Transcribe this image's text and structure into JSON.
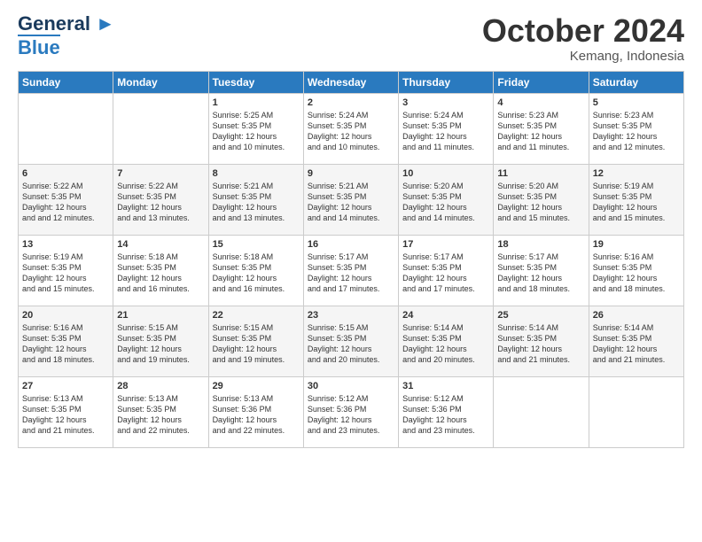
{
  "header": {
    "logo_line1": "General",
    "logo_line2": "Blue",
    "month_title": "October 2024",
    "location": "Kemang, Indonesia"
  },
  "days_of_week": [
    "Sunday",
    "Monday",
    "Tuesday",
    "Wednesday",
    "Thursday",
    "Friday",
    "Saturday"
  ],
  "weeks": [
    [
      {
        "day": "",
        "sunrise": "",
        "sunset": "",
        "daylight": ""
      },
      {
        "day": "",
        "sunrise": "",
        "sunset": "",
        "daylight": ""
      },
      {
        "day": "1",
        "sunrise": "Sunrise: 5:25 AM",
        "sunset": "Sunset: 5:35 PM",
        "daylight": "Daylight: 12 hours and 10 minutes."
      },
      {
        "day": "2",
        "sunrise": "Sunrise: 5:24 AM",
        "sunset": "Sunset: 5:35 PM",
        "daylight": "Daylight: 12 hours and 10 minutes."
      },
      {
        "day": "3",
        "sunrise": "Sunrise: 5:24 AM",
        "sunset": "Sunset: 5:35 PM",
        "daylight": "Daylight: 12 hours and 11 minutes."
      },
      {
        "day": "4",
        "sunrise": "Sunrise: 5:23 AM",
        "sunset": "Sunset: 5:35 PM",
        "daylight": "Daylight: 12 hours and 11 minutes."
      },
      {
        "day": "5",
        "sunrise": "Sunrise: 5:23 AM",
        "sunset": "Sunset: 5:35 PM",
        "daylight": "Daylight: 12 hours and 12 minutes."
      }
    ],
    [
      {
        "day": "6",
        "sunrise": "Sunrise: 5:22 AM",
        "sunset": "Sunset: 5:35 PM",
        "daylight": "Daylight: 12 hours and 12 minutes."
      },
      {
        "day": "7",
        "sunrise": "Sunrise: 5:22 AM",
        "sunset": "Sunset: 5:35 PM",
        "daylight": "Daylight: 12 hours and 13 minutes."
      },
      {
        "day": "8",
        "sunrise": "Sunrise: 5:21 AM",
        "sunset": "Sunset: 5:35 PM",
        "daylight": "Daylight: 12 hours and 13 minutes."
      },
      {
        "day": "9",
        "sunrise": "Sunrise: 5:21 AM",
        "sunset": "Sunset: 5:35 PM",
        "daylight": "Daylight: 12 hours and 14 minutes."
      },
      {
        "day": "10",
        "sunrise": "Sunrise: 5:20 AM",
        "sunset": "Sunset: 5:35 PM",
        "daylight": "Daylight: 12 hours and 14 minutes."
      },
      {
        "day": "11",
        "sunrise": "Sunrise: 5:20 AM",
        "sunset": "Sunset: 5:35 PM",
        "daylight": "Daylight: 12 hours and 15 minutes."
      },
      {
        "day": "12",
        "sunrise": "Sunrise: 5:19 AM",
        "sunset": "Sunset: 5:35 PM",
        "daylight": "Daylight: 12 hours and 15 minutes."
      }
    ],
    [
      {
        "day": "13",
        "sunrise": "Sunrise: 5:19 AM",
        "sunset": "Sunset: 5:35 PM",
        "daylight": "Daylight: 12 hours and 15 minutes."
      },
      {
        "day": "14",
        "sunrise": "Sunrise: 5:18 AM",
        "sunset": "Sunset: 5:35 PM",
        "daylight": "Daylight: 12 hours and 16 minutes."
      },
      {
        "day": "15",
        "sunrise": "Sunrise: 5:18 AM",
        "sunset": "Sunset: 5:35 PM",
        "daylight": "Daylight: 12 hours and 16 minutes."
      },
      {
        "day": "16",
        "sunrise": "Sunrise: 5:17 AM",
        "sunset": "Sunset: 5:35 PM",
        "daylight": "Daylight: 12 hours and 17 minutes."
      },
      {
        "day": "17",
        "sunrise": "Sunrise: 5:17 AM",
        "sunset": "Sunset: 5:35 PM",
        "daylight": "Daylight: 12 hours and 17 minutes."
      },
      {
        "day": "18",
        "sunrise": "Sunrise: 5:17 AM",
        "sunset": "Sunset: 5:35 PM",
        "daylight": "Daylight: 12 hours and 18 minutes."
      },
      {
        "day": "19",
        "sunrise": "Sunrise: 5:16 AM",
        "sunset": "Sunset: 5:35 PM",
        "daylight": "Daylight: 12 hours and 18 minutes."
      }
    ],
    [
      {
        "day": "20",
        "sunrise": "Sunrise: 5:16 AM",
        "sunset": "Sunset: 5:35 PM",
        "daylight": "Daylight: 12 hours and 18 minutes."
      },
      {
        "day": "21",
        "sunrise": "Sunrise: 5:15 AM",
        "sunset": "Sunset: 5:35 PM",
        "daylight": "Daylight: 12 hours and 19 minutes."
      },
      {
        "day": "22",
        "sunrise": "Sunrise: 5:15 AM",
        "sunset": "Sunset: 5:35 PM",
        "daylight": "Daylight: 12 hours and 19 minutes."
      },
      {
        "day": "23",
        "sunrise": "Sunrise: 5:15 AM",
        "sunset": "Sunset: 5:35 PM",
        "daylight": "Daylight: 12 hours and 20 minutes."
      },
      {
        "day": "24",
        "sunrise": "Sunrise: 5:14 AM",
        "sunset": "Sunset: 5:35 PM",
        "daylight": "Daylight: 12 hours and 20 minutes."
      },
      {
        "day": "25",
        "sunrise": "Sunrise: 5:14 AM",
        "sunset": "Sunset: 5:35 PM",
        "daylight": "Daylight: 12 hours and 21 minutes."
      },
      {
        "day": "26",
        "sunrise": "Sunrise: 5:14 AM",
        "sunset": "Sunset: 5:35 PM",
        "daylight": "Daylight: 12 hours and 21 minutes."
      }
    ],
    [
      {
        "day": "27",
        "sunrise": "Sunrise: 5:13 AM",
        "sunset": "Sunset: 5:35 PM",
        "daylight": "Daylight: 12 hours and 21 minutes."
      },
      {
        "day": "28",
        "sunrise": "Sunrise: 5:13 AM",
        "sunset": "Sunset: 5:35 PM",
        "daylight": "Daylight: 12 hours and 22 minutes."
      },
      {
        "day": "29",
        "sunrise": "Sunrise: 5:13 AM",
        "sunset": "Sunset: 5:36 PM",
        "daylight": "Daylight: 12 hours and 22 minutes."
      },
      {
        "day": "30",
        "sunrise": "Sunrise: 5:12 AM",
        "sunset": "Sunset: 5:36 PM",
        "daylight": "Daylight: 12 hours and 23 minutes."
      },
      {
        "day": "31",
        "sunrise": "Sunrise: 5:12 AM",
        "sunset": "Sunset: 5:36 PM",
        "daylight": "Daylight: 12 hours and 23 minutes."
      },
      {
        "day": "",
        "sunrise": "",
        "sunset": "",
        "daylight": ""
      },
      {
        "day": "",
        "sunrise": "",
        "sunset": "",
        "daylight": ""
      }
    ]
  ]
}
